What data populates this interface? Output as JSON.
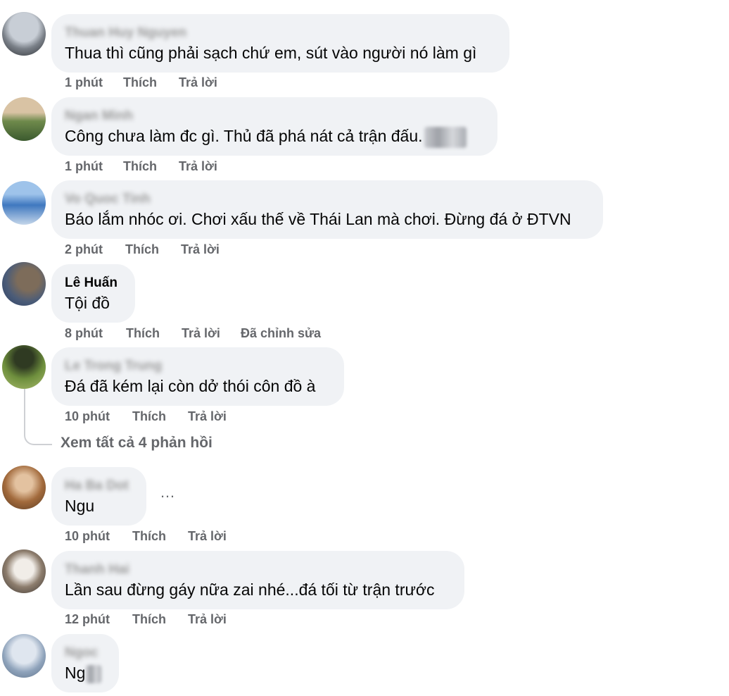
{
  "comments": [
    {
      "name": "",
      "text": "Thua thì cũng phải sạch chứ em, sút vào người nó làm gì",
      "time": "1 phút",
      "like": "Thích",
      "reply": "Trả lời",
      "edited": ""
    },
    {
      "name": "",
      "text": "Công chưa làm đc gì. Thủ đã phá nát cả trận đấu.",
      "time": "1 phút",
      "like": "Thích",
      "reply": "Trả lời",
      "edited": ""
    },
    {
      "name": "",
      "text": "Báo lắm nhóc ơi. Chơi xấu thế về Thái Lan mà chơi. Đừng đá ở ĐTVN",
      "time": "2 phút",
      "like": "Thích",
      "reply": "Trả lời",
      "edited": ""
    },
    {
      "name": "Lê Huấn",
      "text": "Tội đồ",
      "time": "8 phút",
      "like": "Thích",
      "reply": "Trả lời",
      "edited": "Đã chỉnh sửa"
    },
    {
      "name": "",
      "text": "Đá đã kém lại còn dở thói côn đồ à",
      "time": "10 phút",
      "like": "Thích",
      "reply": "Trả lời",
      "edited": ""
    },
    {
      "name": "",
      "text": "Ngu",
      "time": "10 phút",
      "like": "Thích",
      "reply": "Trả lời",
      "edited": ""
    },
    {
      "name": "",
      "text": "Lần sau đừng gáy nữa zai nhé...đá tối từ trận trước",
      "time": "12 phút",
      "like": "Thích",
      "reply": "Trả lời",
      "edited": ""
    },
    {
      "name": "",
      "text": "Ng",
      "time": "",
      "like": "",
      "reply": "",
      "edited": ""
    }
  ],
  "view_replies": "Xem tất cả 4 phản hồi",
  "more_icon": "…",
  "colors": {
    "bubble": "#f0f2f5",
    "meta": "#65676b",
    "text": "#050505"
  },
  "icons": [
    "more-options-icon"
  ]
}
